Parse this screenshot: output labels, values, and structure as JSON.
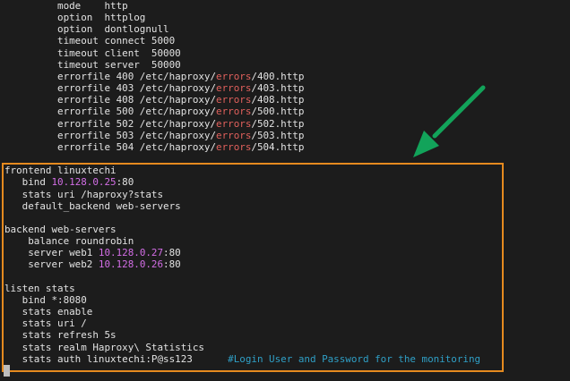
{
  "terminal": {
    "lines": [
      [
        {
          "t": "         mode    http"
        }
      ],
      [
        {
          "t": "         option  httplog"
        }
      ],
      [
        {
          "t": "         option  dontlognull"
        }
      ],
      [
        {
          "t": "         timeout connect 5000"
        }
      ],
      [
        {
          "t": "         timeout client  50000"
        }
      ],
      [
        {
          "t": "         timeout server  50000"
        }
      ],
      [
        {
          "t": "         errorfile 400 /etc/haproxy/"
        },
        {
          "t": "errors",
          "c": "red"
        },
        {
          "t": "/400.http"
        }
      ],
      [
        {
          "t": "         errorfile 403 /etc/haproxy/"
        },
        {
          "t": "errors",
          "c": "red"
        },
        {
          "t": "/403.http"
        }
      ],
      [
        {
          "t": "         errorfile 408 /etc/haproxy/"
        },
        {
          "t": "errors",
          "c": "red"
        },
        {
          "t": "/408.http"
        }
      ],
      [
        {
          "t": "         errorfile 500 /etc/haproxy/"
        },
        {
          "t": "errors",
          "c": "red"
        },
        {
          "t": "/500.http"
        }
      ],
      [
        {
          "t": "         errorfile 502 /etc/haproxy/"
        },
        {
          "t": "errors",
          "c": "red"
        },
        {
          "t": "/502.http"
        }
      ],
      [
        {
          "t": "         errorfile 503 /etc/haproxy/"
        },
        {
          "t": "errors",
          "c": "red"
        },
        {
          "t": "/503.http"
        }
      ],
      [
        {
          "t": "         errorfile 504 /etc/haproxy/"
        },
        {
          "t": "errors",
          "c": "red"
        },
        {
          "t": "/504.http"
        }
      ],
      [],
      [
        {
          "t": "frontend linuxtechi"
        }
      ],
      [
        {
          "t": "   bind "
        },
        {
          "t": "10.128.0.25",
          "c": "mag"
        },
        {
          "t": ":80"
        }
      ],
      [
        {
          "t": "   stats uri /haproxy?stats"
        }
      ],
      [
        {
          "t": "   default_backend web-servers"
        }
      ],
      [],
      [
        {
          "t": "backend web-servers"
        }
      ],
      [
        {
          "t": "    balance roundrobin"
        }
      ],
      [
        {
          "t": "    server web1 "
        },
        {
          "t": "10.128.0.27",
          "c": "mag"
        },
        {
          "t": ":80"
        }
      ],
      [
        {
          "t": "    server web2 "
        },
        {
          "t": "10.128.0.26",
          "c": "mag"
        },
        {
          "t": ":80"
        }
      ],
      [],
      [
        {
          "t": "listen stats"
        }
      ],
      [
        {
          "t": "   bind *:8080"
        }
      ],
      [
        {
          "t": "   stats enable"
        }
      ],
      [
        {
          "t": "   stats uri /"
        }
      ],
      [
        {
          "t": "   stats refresh 5s"
        }
      ],
      [
        {
          "t": "   stats realm Haproxy\\ Statistics"
        }
      ],
      [
        {
          "t": "   stats auth linuxtechi:P@ss123      "
        },
        {
          "t": "#Login User and Password for the monitoring",
          "c": "cyan"
        }
      ]
    ]
  },
  "colors": {
    "highlight_box": "#e58a1f",
    "arrow": "#12a35a",
    "background": "#1c1c1c"
  }
}
